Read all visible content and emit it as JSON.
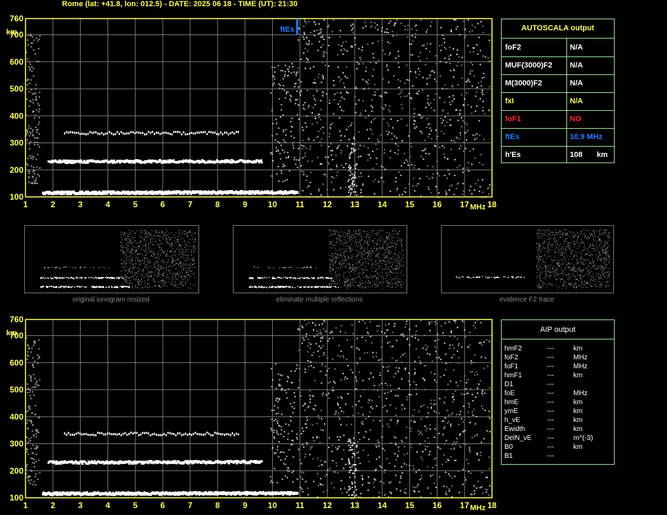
{
  "header": "Rome (lat: +41.8, lon: 012.5) - DATE: 2025 06 18 - TIME (UT): 21:30",
  "colors": {
    "axis": "#ffff66",
    "grid": "#7a7a7a",
    "trace": "#ffffff",
    "ftEs": "#2a7cff",
    "box": "#9fe39f",
    "red": "#ff2a2a"
  },
  "chart_data": [
    {
      "type": "scatter",
      "title": "",
      "xlabel": "MHz",
      "ylabel": "km",
      "xlim": [
        1,
        18
      ],
      "ylim": [
        100,
        760
      ],
      "x_ticks": [
        "1",
        "2",
        "3",
        "4",
        "5",
        "6",
        "7",
        "8",
        "9",
        "10",
        "11",
        "12",
        "13",
        "14",
        "15",
        "16",
        "17",
        "18"
      ],
      "y_ticks": [
        "100",
        "200",
        "300",
        "400",
        "500",
        "600",
        "700",
        "760"
      ],
      "grid": true,
      "series": [
        {
          "values": [
            [
              1.6,
              120
            ],
            [
              10.9,
              122
            ]
          ],
          "kind": "E-layer trace"
        },
        {
          "values": [
            [
              1.8,
              234
            ],
            [
              9.6,
              236
            ]
          ],
          "kind": "2nd reflection"
        },
        {
          "values": [
            [
              2.4,
              340
            ],
            [
              8.8,
              340
            ]
          ],
          "kind": "3rd reflection"
        }
      ],
      "annotations": [
        {
          "text": "ftEs",
          "x": 10.9
        }
      ]
    },
    {
      "type": "scatter",
      "title": "",
      "xlabel": "MHz",
      "ylabel": "km",
      "xlim": [
        1,
        18
      ],
      "ylim": [
        100,
        760
      ],
      "x_ticks": [
        "1",
        "2",
        "3",
        "4",
        "5",
        "6",
        "7",
        "8",
        "9",
        "10",
        "11",
        "12",
        "13",
        "14",
        "15",
        "16",
        "17",
        "18"
      ],
      "y_ticks": [
        "100",
        "200",
        "300",
        "400",
        "500",
        "600",
        "700",
        "760"
      ],
      "grid": true
    }
  ],
  "autoscala": {
    "title": "AUTOSCALA output",
    "rows": [
      {
        "label": "foF2",
        "value": "N/A",
        "color": "#ffffff"
      },
      {
        "label": "MUF(3000)F2",
        "value": "N/A",
        "color": "#ffffff"
      },
      {
        "label": "M(3000)F2",
        "value": "N/A",
        "color": "#ffffff"
      },
      {
        "label": "fxI",
        "value": "N/A",
        "color": "#ffff66"
      },
      {
        "label": "foF1",
        "value": "NO",
        "color": "#ff2a2a"
      },
      {
        "label": "ftEs",
        "value": "10.9 MHz",
        "color": "#2a7cff"
      },
      {
        "label": "h'Es",
        "value": "108",
        "unit": "km",
        "color": "#ffffff"
      }
    ]
  },
  "thumbnails": [
    {
      "caption": "original ionogram resized"
    },
    {
      "caption": "eliminate multiple reflections"
    },
    {
      "caption": "evidence F2 trace"
    }
  ],
  "aip": {
    "title": "AIP output",
    "rows": [
      {
        "label": "hmF2",
        "value": "---",
        "unit": "km"
      },
      {
        "label": "foF2",
        "value": "---",
        "unit": "MHz"
      },
      {
        "label": "foF1",
        "value": "---",
        "unit": "MHz"
      },
      {
        "label": "hmF1",
        "value": "---",
        "unit": "km"
      },
      {
        "label": "D1",
        "value": "---",
        "unit": ""
      },
      {
        "label": "foE",
        "value": "---",
        "unit": "MHz"
      },
      {
        "label": "hmE",
        "value": "---",
        "unit": "km"
      },
      {
        "label": "ymE",
        "value": "---",
        "unit": "km"
      },
      {
        "label": "h_vE",
        "value": "---",
        "unit": "km"
      },
      {
        "label": "Ewidth",
        "value": "---",
        "unit": "km"
      },
      {
        "label": "DelN_vE",
        "value": "---",
        "unit": "m^(-3)"
      },
      {
        "label": "B0",
        "value": "---",
        "unit": "km"
      },
      {
        "label": "B1",
        "value": "---",
        "unit": ""
      }
    ]
  }
}
